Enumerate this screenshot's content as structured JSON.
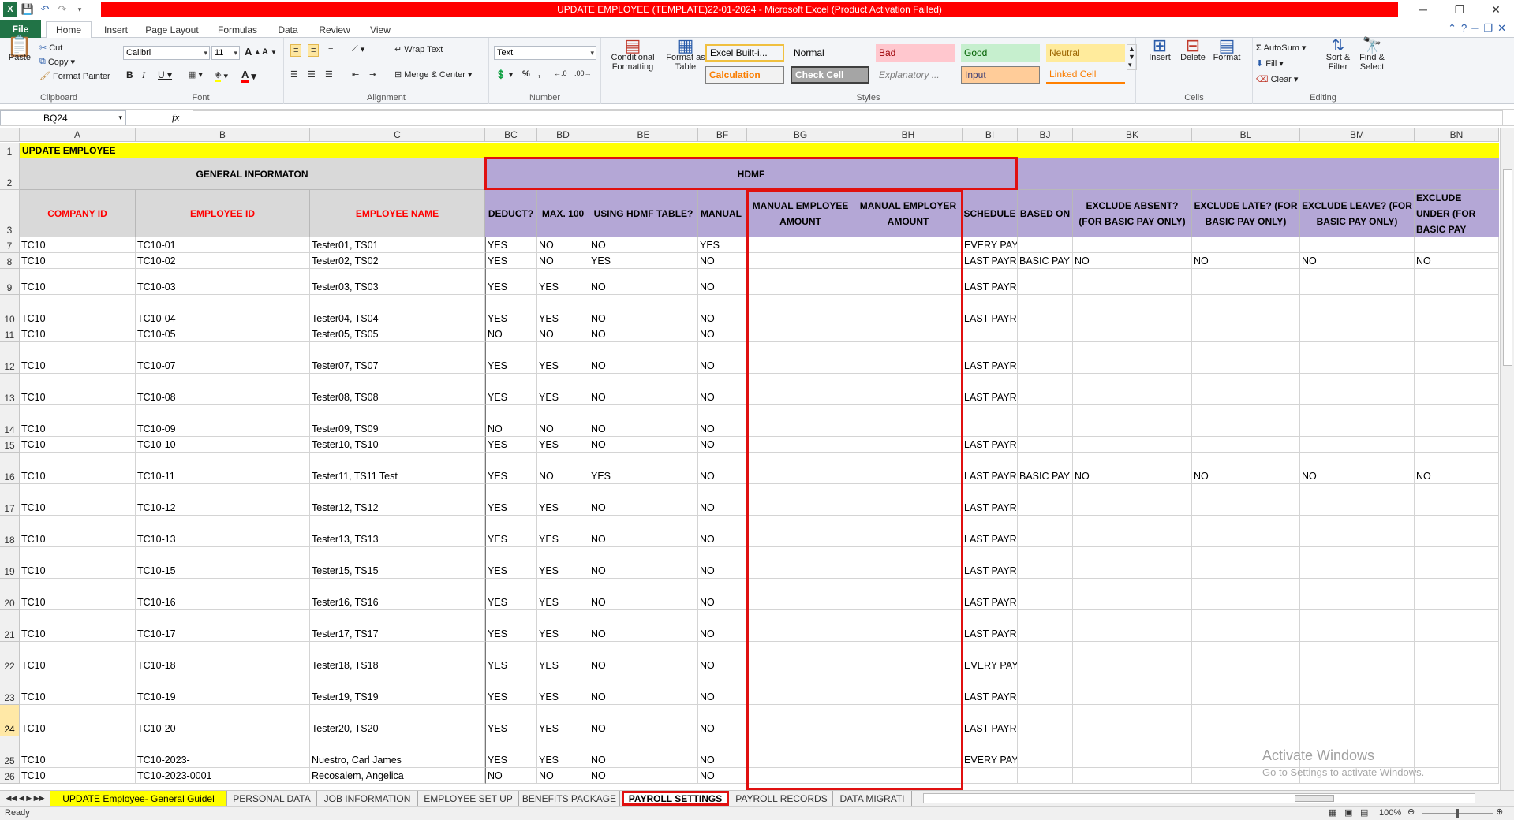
{
  "window": {
    "title": "UPDATE EMPLOYEE (TEMPLATE)22-01-2024 - Microsoft Excel (Product Activation Failed)"
  },
  "ribbon_tabs": [
    "File",
    "Home",
    "Insert",
    "Page Layout",
    "Formulas",
    "Data",
    "Review",
    "View"
  ],
  "clipboard": {
    "paste": "Paste",
    "cut": "Cut",
    "copy": "Copy",
    "format_painter": "Format Painter",
    "label": "Clipboard"
  },
  "font": {
    "name": "Calibri",
    "size": "11",
    "label": "Font"
  },
  "alignment": {
    "wrap": "Wrap Text",
    "merge": "Merge & Center",
    "label": "Alignment"
  },
  "number": {
    "format": "Text",
    "label": "Number"
  },
  "styles": {
    "conditional": "Conditional Formatting",
    "format_table": "Format as Table",
    "label": "Styles",
    "cells": [
      {
        "text": "Excel Built-i...",
        "bg": "#ffffff",
        "fg": "#000000"
      },
      {
        "text": "Normal",
        "bg": "#ffffff",
        "fg": "#000000"
      },
      {
        "text": "Bad",
        "bg": "#ffc7ce",
        "fg": "#9c0006"
      },
      {
        "text": "Good",
        "bg": "#c6efce",
        "fg": "#006100"
      },
      {
        "text": "Neutral",
        "bg": "#ffeb9c",
        "fg": "#9c6500"
      },
      {
        "text": "Calculation",
        "bg": "#f2f2f2",
        "fg": "#fa7d00"
      },
      {
        "text": "Check Cell",
        "bg": "#a5a5a5",
        "fg": "#ffffff"
      },
      {
        "text": "Explanatory ...",
        "bg": "#ffffff",
        "fg": "#7f7f7f"
      },
      {
        "text": "Input",
        "bg": "#ffcc99",
        "fg": "#3f3f76"
      },
      {
        "text": "Linked Cell",
        "bg": "#ffffff",
        "fg": "#fa7d00"
      }
    ]
  },
  "cells_group": {
    "insert": "Insert",
    "delete": "Delete",
    "format": "Format",
    "label": "Cells"
  },
  "editing": {
    "autosum": "AutoSum",
    "fill": "Fill",
    "clear": "Clear",
    "sort": "Sort & Filter",
    "find": "Find & Select",
    "label": "Editing"
  },
  "formula_bar": {
    "name_box": "BQ24",
    "fx": "fx",
    "value": ""
  },
  "columns": [
    "A",
    "B",
    "C",
    "BC",
    "BD",
    "BE",
    "BF",
    "BG",
    "BH",
    "BI",
    "BJ",
    "BK",
    "BL",
    "BM",
    "BN"
  ],
  "sheet": {
    "title": "UPDATE EMPLOYEE",
    "general": "GENERAL INFORMATON",
    "hdmf": "HDMF",
    "headers": {
      "company": "COMPANY ID",
      "employee_id": "EMPLOYEE ID",
      "employee_name": "EMPLOYEE NAME",
      "deduct": "DEDUCT?",
      "max100": "MAX. 100",
      "using_table": "USING HDMF TABLE?",
      "manual": "MANUAL",
      "manual_emp": "MANUAL EMPLOYEE AMOUNT",
      "manual_er": "MANUAL EMPLOYER AMOUNT",
      "schedule": "SCHEDULE",
      "based_on": "BASED ON",
      "excl_absent": "EXCLUDE ABSENT? (FOR BASIC PAY ONLY)",
      "excl_late": "EXCLUDE LATE? (FOR BASIC PAY ONLY)",
      "excl_leave": "EXCLUDE LEAVE? (FOR BASIC PAY ONLY)",
      "excl_under": "EXCLUDE UNDER (FOR BASIC PAY"
    },
    "rows": [
      {
        "n": "7",
        "c": [
          "TC10",
          "TC10-01",
          "Tester01, TS01",
          "YES",
          "NO",
          "NO",
          "YES",
          "",
          "",
          "EVERY PAYROLL",
          "",
          "",
          "",
          "",
          ""
        ]
      },
      {
        "n": "8",
        "c": [
          "TC10",
          "TC10-02",
          "Tester02, TS02",
          "YES",
          "NO",
          "YES",
          "NO",
          "",
          "",
          "LAST PAYR(",
          "BASIC PAY",
          "NO",
          "NO",
          "NO",
          "NO"
        ]
      },
      {
        "n": "9",
        "c": [
          "TC10",
          "TC10-03",
          "Tester03, TS03",
          "YES",
          "YES",
          "NO",
          "NO",
          "",
          "",
          "LAST PAYROLL",
          "",
          "",
          "",
          "",
          ""
        ]
      },
      {
        "n": "10",
        "c": [
          "TC10",
          "TC10-04",
          "Tester04, TS04",
          "YES",
          "YES",
          "NO",
          "NO",
          "",
          "",
          "LAST PAYROLL",
          "",
          "",
          "",
          "",
          ""
        ]
      },
      {
        "n": "11",
        "c": [
          "TC10",
          "TC10-05",
          "Tester05, TS05",
          "NO",
          "NO",
          "NO",
          "NO",
          "",
          "",
          "",
          "",
          "",
          "",
          "",
          ""
        ]
      },
      {
        "n": "12",
        "c": [
          "TC10",
          "TC10-07",
          "Tester07, TS07",
          "YES",
          "YES",
          "NO",
          "NO",
          "",
          "",
          "LAST PAYROLL",
          "",
          "",
          "",
          "",
          ""
        ]
      },
      {
        "n": "13",
        "c": [
          "TC10",
          "TC10-08",
          "Tester08, TS08",
          "YES",
          "YES",
          "NO",
          "NO",
          "",
          "",
          "LAST PAYROLL",
          "",
          "",
          "",
          "",
          ""
        ]
      },
      {
        "n": "14",
        "c": [
          "TC10",
          "TC10-09",
          "Tester09, TS09",
          "NO",
          "NO",
          "NO",
          "NO",
          "",
          "",
          "",
          "",
          "",
          "",
          "",
          ""
        ]
      },
      {
        "n": "15",
        "c": [
          "TC10",
          "TC10-10",
          "Tester10, TS10",
          "YES",
          "YES",
          "NO",
          "NO",
          "",
          "",
          "LAST PAYROLL",
          "",
          "",
          "",
          "",
          ""
        ]
      },
      {
        "n": "16",
        "c": [
          "TC10",
          "TC10-11",
          "Tester11, TS11 Test",
          "YES",
          "NO",
          "YES",
          "NO",
          "",
          "",
          "LAST PAYR(",
          "BASIC PAY",
          "NO",
          "NO",
          "NO",
          "NO"
        ]
      },
      {
        "n": "17",
        "c": [
          "TC10",
          "TC10-12",
          "Tester12, TS12",
          "YES",
          "YES",
          "NO",
          "NO",
          "",
          "",
          "LAST PAYROLL",
          "",
          "",
          "",
          "",
          ""
        ]
      },
      {
        "n": "18",
        "c": [
          "TC10",
          "TC10-13",
          "Tester13, TS13",
          "YES",
          "YES",
          "NO",
          "NO",
          "",
          "",
          "LAST PAYROLL",
          "",
          "",
          "",
          "",
          ""
        ]
      },
      {
        "n": "19",
        "c": [
          "TC10",
          "TC10-15",
          "Tester15, TS15",
          "YES",
          "YES",
          "NO",
          "NO",
          "",
          "",
          "LAST PAYROLL",
          "",
          "",
          "",
          "",
          ""
        ]
      },
      {
        "n": "20",
        "c": [
          "TC10",
          "TC10-16",
          "Tester16, TS16",
          "YES",
          "YES",
          "NO",
          "NO",
          "",
          "",
          "LAST PAYROLL",
          "",
          "",
          "",
          "",
          ""
        ]
      },
      {
        "n": "21",
        "c": [
          "TC10",
          "TC10-17",
          "Tester17, TS17",
          "YES",
          "YES",
          "NO",
          "NO",
          "",
          "",
          "LAST PAYROLL",
          "",
          "",
          "",
          "",
          ""
        ]
      },
      {
        "n": "22",
        "c": [
          "TC10",
          "TC10-18",
          "Tester18, TS18",
          "YES",
          "YES",
          "NO",
          "NO",
          "",
          "",
          "EVERY PAYROLL",
          "",
          "",
          "",
          "",
          ""
        ]
      },
      {
        "n": "23",
        "c": [
          "TC10",
          "TC10-19",
          "Tester19, TS19",
          "YES",
          "YES",
          "NO",
          "NO",
          "",
          "",
          "LAST PAYROLL",
          "",
          "",
          "",
          "",
          ""
        ]
      },
      {
        "n": "24",
        "c": [
          "TC10",
          "TC10-20",
          "Tester20, TS20",
          "YES",
          "YES",
          "NO",
          "NO",
          "",
          "",
          "LAST PAYROLL",
          "",
          "",
          "",
          "",
          ""
        ]
      },
      {
        "n": "25",
        "c": [
          "TC10",
          "TC10-2023-",
          "Nuestro, Carl James",
          "YES",
          "YES",
          "NO",
          "NO",
          "",
          "",
          "EVERY PAYROLL",
          "",
          "",
          "",
          "",
          ""
        ]
      },
      {
        "n": "26",
        "c": [
          "TC10",
          "TC10-2023-0001",
          "Recosalem, Angelica",
          "NO",
          "NO",
          "NO",
          "NO",
          "",
          "",
          "",
          "",
          "",
          "",
          "",
          ""
        ]
      }
    ]
  },
  "sheet_tabs": [
    "UPDATE Employee- General Guidel",
    "PERSONAL DATA",
    "JOB INFORMATION",
    "EMPLOYEE SET UP",
    "BENEFITS PACKAGE",
    "PAYROLL SETTINGS",
    "PAYROLL RECORDS",
    "DATA MIGRATI"
  ],
  "status": {
    "ready": "Ready",
    "zoom": "100%"
  },
  "watermark": {
    "line1": "Activate Windows",
    "line2": "Go to Settings to activate Windows."
  }
}
